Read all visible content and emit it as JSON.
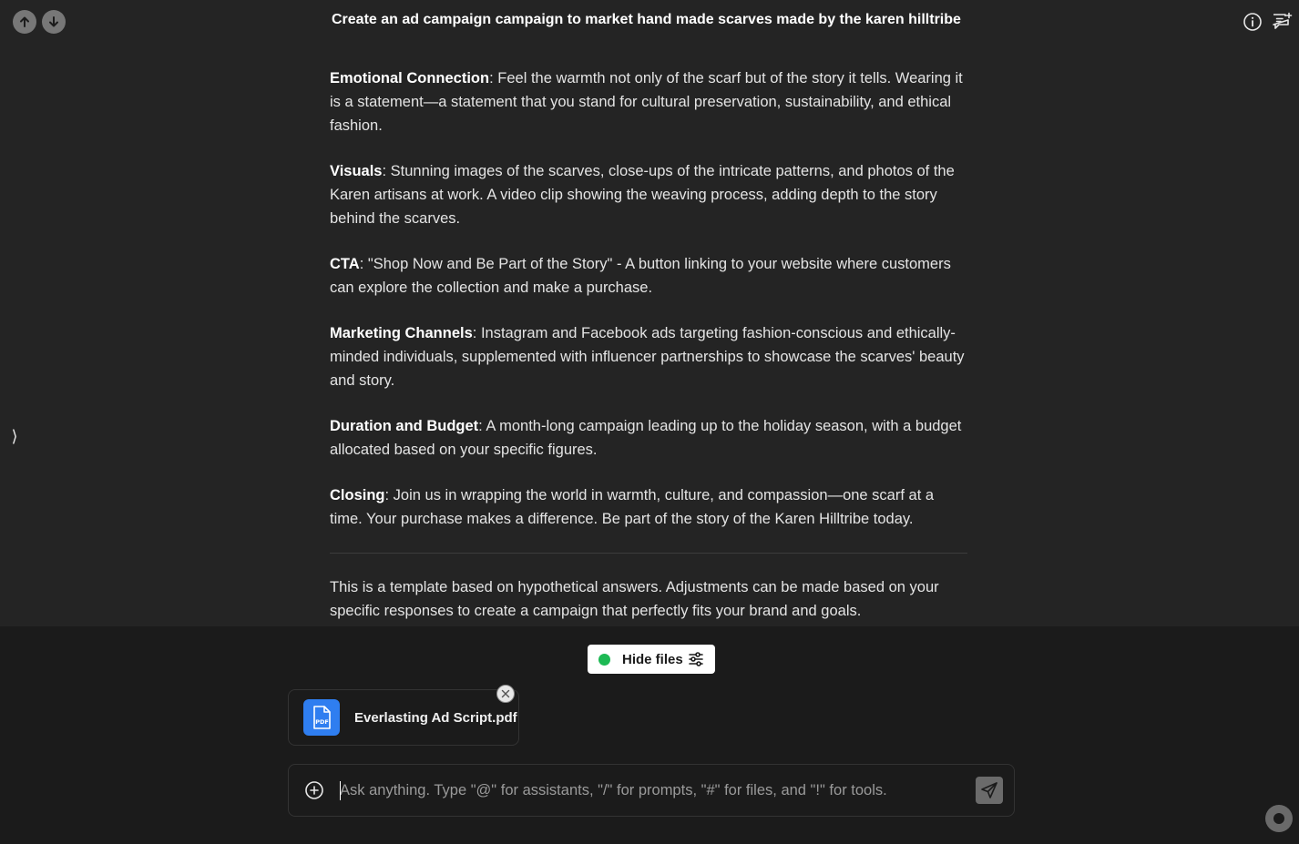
{
  "header": {
    "title": "Create an ad campaign campaign to market hand made scarves made by the karen hilltribe",
    "nav_up_icon": "arrow-up-icon",
    "nav_down_icon": "arrow-down-icon",
    "info_icon": "info-icon",
    "new_chat_icon": "new-chat-icon"
  },
  "sidebar": {
    "toggle_glyph": "⟩"
  },
  "message": {
    "sections": [
      {
        "heading": "Emotional Connection",
        "text": ": Feel the warmth not only of the scarf but of the story it tells. Wearing it is a statement—a statement that you stand for cultural preservation, sustainability, and ethical fashion."
      },
      {
        "heading": "Visuals",
        "text": ": Stunning images of the scarves, close-ups of the intricate patterns, and photos of the Karen artisans at work. A video clip showing the weaving process, adding depth to the story behind the scarves."
      },
      {
        "heading": "CTA",
        "text": ": \"Shop Now and Be Part of the Story\" - A button linking to your website where customers can explore the collection and make a purchase."
      },
      {
        "heading": "Marketing Channels",
        "text": ": Instagram and Facebook ads targeting fashion-conscious and ethically-minded individuals, supplemented with influencer partnerships to showcase the scarves' beauty and story."
      },
      {
        "heading": "Duration and Budget",
        "text": ": A month-long campaign leading up to the holiday season, with a budget allocated based on your specific figures."
      },
      {
        "heading": "Closing",
        "text": ": Join us in wrapping the world in warmth, culture, and compassion—one scarf at a time. Your purchase makes a difference. Be part of the story of the Karen Hilltribe today."
      }
    ],
    "footer_note": "This is a template based on hypothetical answers. Adjustments can be made based on your specific responses to create a campaign that perfectly fits your brand and goals."
  },
  "files": {
    "toggle_label": "Hide files",
    "status_color": "#1db954",
    "attachments": [
      {
        "name": "Everlasting Ad Script.pdf",
        "icon": "pdf-file-icon",
        "icon_text": "PDF",
        "icon_color": "#2f7ef0"
      }
    ]
  },
  "composer": {
    "placeholder": "Ask anything. Type \"@\" for assistants, \"/\" for prompts, \"#\" for files, and \"!\" for tools.",
    "value": "",
    "attach_icon": "plus-circle-icon",
    "send_icon": "send-icon"
  }
}
